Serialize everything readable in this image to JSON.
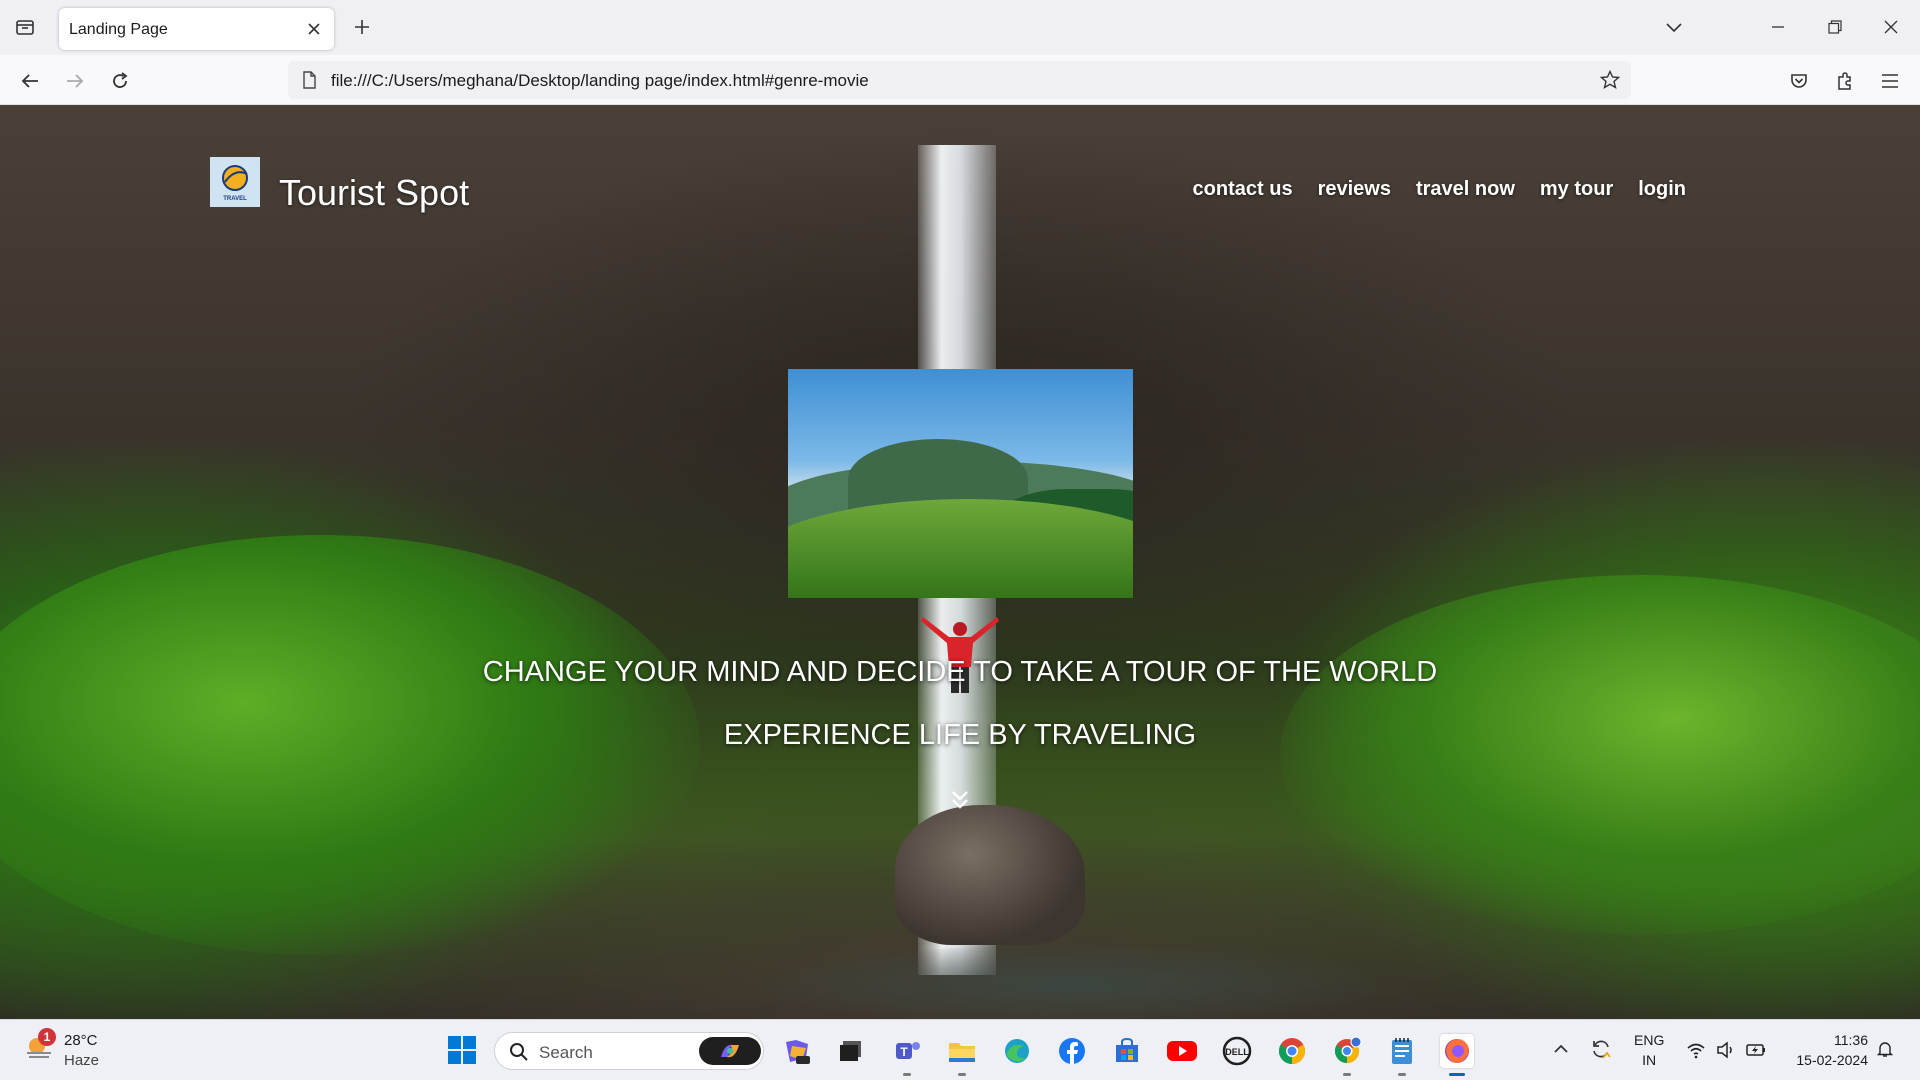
{
  "browser": {
    "tab_title": "Landing Page",
    "url": "file:///C:/Users/meghana/Desktop/landing page/index.html#genre-movie"
  },
  "site": {
    "title": "Tourist Spot",
    "logo_text": "TRAVEL",
    "nav": [
      "contact us",
      "reviews",
      "travel now",
      "my tour",
      "login"
    ],
    "tagline_1": "CHANGE YOUR MIND AND DECIDE TO TAKE A TOUR OF THE WORLD",
    "tagline_2": "EXPERIENCE LIFE BY TRAVELING"
  },
  "taskbar": {
    "weather_temp": "28°C",
    "weather_condition": "Haze",
    "weather_badge": "1",
    "search_label": "Search",
    "apps": [
      "copilot-icon",
      "pre-icon",
      "task-view-icon",
      "teams-icon",
      "file-explorer-icon",
      "edge-icon",
      "facebook-icon",
      "store-icon",
      "youtube-icon",
      "dell-icon",
      "chrome-icon",
      "chrome-profile-icon",
      "notepad-icon",
      "firefox-icon"
    ],
    "lang_1": "ENG",
    "lang_2": "IN",
    "time": "11:36",
    "date": "15-02-2024"
  },
  "colors": {
    "accent": "#0067c0",
    "weather_badge": "#d13438"
  }
}
